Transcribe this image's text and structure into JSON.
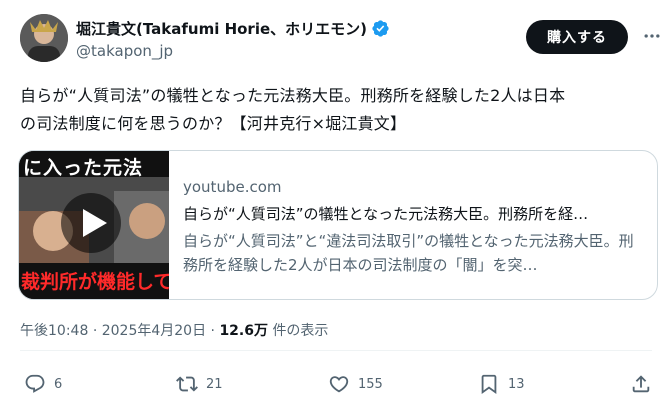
{
  "author": {
    "display_name": "堀江貴文(Takafumi Horie、ホリエモン)",
    "handle": "@takapon_jp"
  },
  "header": {
    "subscribe_label": "購入する"
  },
  "post": {
    "text": "自らが“人質司法”の犠牲となった元法務大臣。刑務所を経験した2人は日本\nの司法制度に何を思うのか？【河井克行×堀江貴文】"
  },
  "link_card": {
    "domain": "youtube.com",
    "title": "自らが“人質司法”の犠牲となった元法務大臣。刑務所を経…",
    "description": "自らが“人質司法”と“違法司法取引”の犠牲となった元法務大臣。刑務所を経験した2人が日本の司法制度の「闇」を突…",
    "thumbnail_top_text": "に入った元法",
    "thumbnail_bottom_text": "裁判所が機能して"
  },
  "meta": {
    "time": "午後10:48",
    "separator": "·",
    "date": "2025年4月20日",
    "views_count": "12.6万",
    "views_label": "件の表示"
  },
  "actions": {
    "replies": "6",
    "reposts": "21",
    "likes": "155",
    "bookmarks": "13"
  },
  "colors": {
    "text_primary": "#0f1419",
    "text_secondary": "#536471",
    "verified_blue": "#1d9bf0",
    "border": "#cfd9de"
  }
}
